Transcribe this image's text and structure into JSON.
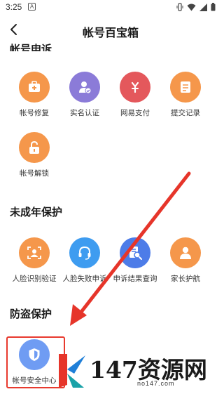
{
  "status": {
    "time": "3:25",
    "notification": "A"
  },
  "header": {
    "title": "帐号百宝箱"
  },
  "sections": [
    {
      "title": "帐号申诉",
      "items": [
        {
          "label": "帐号修复",
          "icon": "medical-kit-icon",
          "color": "#f5974b"
        },
        {
          "label": "实名认证",
          "icon": "user-verified-icon",
          "color": "#8b7bd8"
        },
        {
          "label": "网易支付",
          "icon": "netease-pay-icon",
          "color": "#e4585c"
        },
        {
          "label": "提交记录",
          "icon": "document-icon",
          "color": "#f5974b"
        },
        {
          "label": "帐号解锁",
          "icon": "unlock-icon",
          "color": "#f5974b"
        }
      ]
    },
    {
      "title": "未成年保护",
      "items": [
        {
          "label": "人脸识别验证",
          "icon": "face-scan-icon",
          "color": "#f5974b"
        },
        {
          "label": "人脸失败申诉",
          "icon": "headset-icon",
          "color": "#3e9cf0"
        },
        {
          "label": "申诉结果查询",
          "icon": "search-doc-icon",
          "color": "#4d7ce8"
        },
        {
          "label": "家长护航",
          "icon": "parent-icon",
          "color": "#f5974b"
        }
      ]
    },
    {
      "title": "防盗保护",
      "items": [
        {
          "label": "帐号安全中心",
          "icon": "shield-icon",
          "color": "#6f9cf3"
        }
      ]
    }
  ],
  "watermark": {
    "text": "147资源网",
    "domain": "no147.com"
  }
}
